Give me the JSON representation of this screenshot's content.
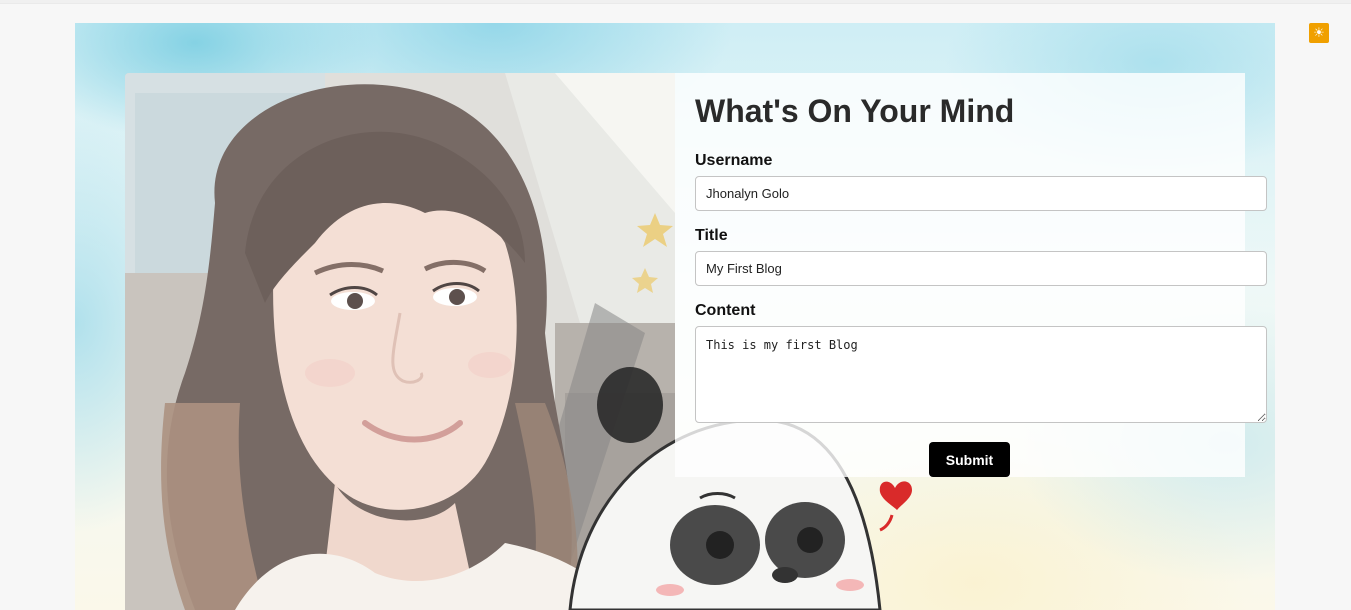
{
  "theme_toggle": {
    "icon": "sun-icon",
    "glyph": "☀",
    "color": "#f0a000"
  },
  "form": {
    "title": "What's On Your Mind",
    "username_label": "Username",
    "username_value": "Jhonalyn Golo",
    "title_label": "Title",
    "title_value": "My First Blog",
    "content_label": "Content",
    "content_value": "This is my first Blog",
    "submit_label": "Submit"
  },
  "colors": {
    "submit_bg": "#000000",
    "accent": "#f0a000"
  }
}
